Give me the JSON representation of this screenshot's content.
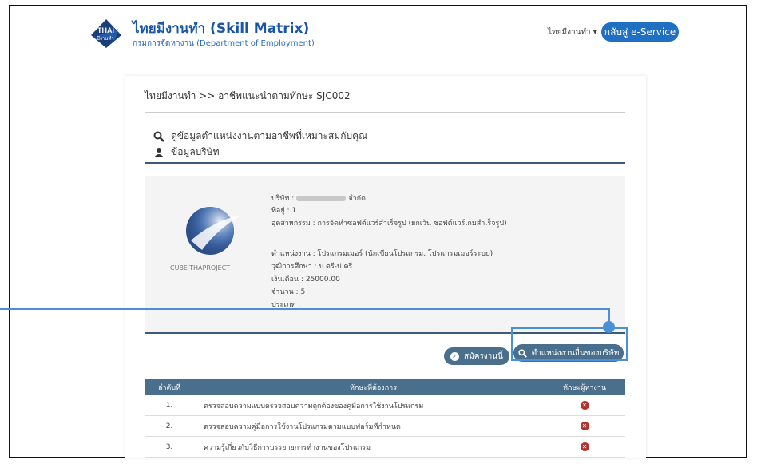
{
  "header": {
    "brand_title": "ไทยมีงานทำ (Skill Matrix)",
    "brand_subtitle": "กรมการจัดหางาน (Department of Employment)",
    "logo_text_top": "THAI",
    "logo_text_bottom": "มีงานทำ",
    "nav_menu": "ไทยมีงานทำ ▾",
    "eservice_button": "กลับสู่ e-Service"
  },
  "breadcrumb": "ไทยมีงานทำ >> อาชีพแนะนำตามทักษะ SJC002",
  "sections": {
    "search_title": "ดูข้อมูลตำแหน่งงานตามอาชีพที่เหมาะสมกับคุณ",
    "company_title": "ข้อมูลบริษัท"
  },
  "company": {
    "name_prefix": "บริษัท :",
    "name_suffix": "จำกัด",
    "address": "ที่อยู่ : 1",
    "industry": "อุตสาหกรรม : การจัดทำซอฟต์แวร์สำเร็จรูป (ยกเว้น ซอฟต์แวร์เกมสำเร็จรูป)",
    "position": "ตำแหน่งงาน : โปรแกรมเมอร์ (นักเขียนโปรแกรม, โปรแกรมเมอร์ระบบ)",
    "education": "วุฒิการศึกษา : ป.ตรี-ป.ตรี",
    "salary": "เงินเดือน : 25000.00",
    "count": "จำนวน : 5",
    "type": "ประเภท :",
    "logo_caption": "CUBE-THAPROJECT"
  },
  "buttons": {
    "apply": "สมัครงานนี้",
    "other_positions": "ตำแหน่งงานอื่นของบริษัท"
  },
  "table": {
    "headers": [
      "ลำดับที่",
      "ทักษะที่ต้องการ",
      "ทักษะผู้หางาน"
    ],
    "rows": [
      {
        "no": "1.",
        "skill": "ตรวจสอบความแบบตรวจสอบความถูกต้องของคู่มือการใช้งานโปรแกรม"
      },
      {
        "no": "2.",
        "skill": "ตรวจสอบความคู่มือการใช้งานโปรแกรมตามแบบฟอร์มที่กำหนด"
      },
      {
        "no": "3.",
        "skill": "ความรู้เกี่ยวกับวิธีการบรรยายการทำงานของโปรแกรม"
      }
    ]
  },
  "colors": {
    "primary": "#1f6fc2",
    "button_dark": "#4a6f8c",
    "highlight": "#4a90d9",
    "missing_skill": "#b0322a"
  }
}
